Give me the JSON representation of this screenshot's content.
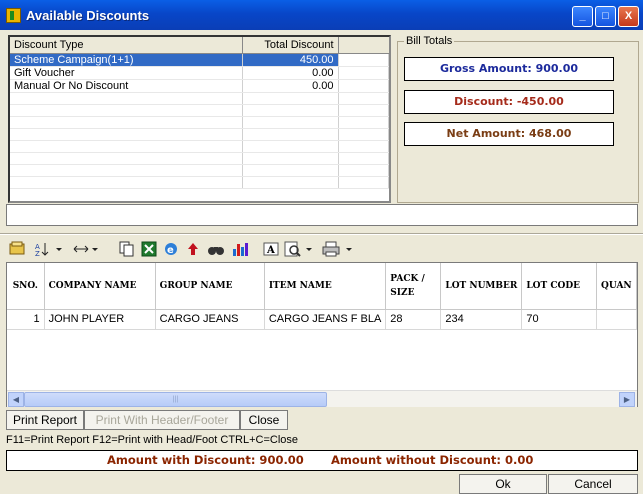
{
  "window": {
    "title": "Available Discounts",
    "min_label": "_",
    "max_label": "□",
    "close_label": "X"
  },
  "discount_list": {
    "columns": [
      "Discount Type",
      "Total Discount"
    ],
    "rows": [
      {
        "type": "Scheme Campaign(1+1)",
        "amount": "450.00",
        "selected": true
      },
      {
        "type": "Gift Voucher",
        "amount": "0.00",
        "selected": false
      },
      {
        "type": "Manual Or No Discount",
        "amount": "0.00",
        "selected": false
      }
    ]
  },
  "bill_totals": {
    "legend": "Bill Totals",
    "gross": "Gross Amount: 900.00",
    "discount": "Discount:  -450.00",
    "net": "Net Amount:  468.00",
    "colors": {
      "gross": "#1c2a9c",
      "discount": "#a52a1a",
      "net": "#7a3d14"
    }
  },
  "toolbar": {
    "icons": [
      "open-icon",
      "sort-icon",
      "column-width-icon",
      "copy-icon",
      "excel-icon",
      "browser-icon",
      "export-arrow-icon",
      "find-icon",
      "chart-icon",
      "font-icon",
      "print-preview-icon",
      "print-icon"
    ]
  },
  "items_grid": {
    "columns": [
      "SNO.",
      "COMPANY NAME",
      "GROUP NAME",
      "ITEM NAME",
      "PACK / SIZE",
      "LOT NUMBER",
      "LOT CODE",
      "QUAN"
    ],
    "rows": [
      {
        "sno": "1",
        "company": "JOHN PLAYER",
        "group": "CARGO JEANS",
        "item": "CARGO JEANS F BLA",
        "pack": "28",
        "lot_number": "234",
        "lot_code": "70",
        "qty": ""
      }
    ]
  },
  "buttons": {
    "print_report": "Print Report",
    "print_header_footer": "Print With Header/Footer",
    "close": "Close",
    "ok": "Ok",
    "cancel": "Cancel"
  },
  "shortcuts": "F11=Print Report  F12=Print with Head/Foot  CTRL+C=Close",
  "summary": {
    "with_discount": "Amount with Discount: 900.00",
    "without_discount": "Amount without Discount: 0.00"
  }
}
